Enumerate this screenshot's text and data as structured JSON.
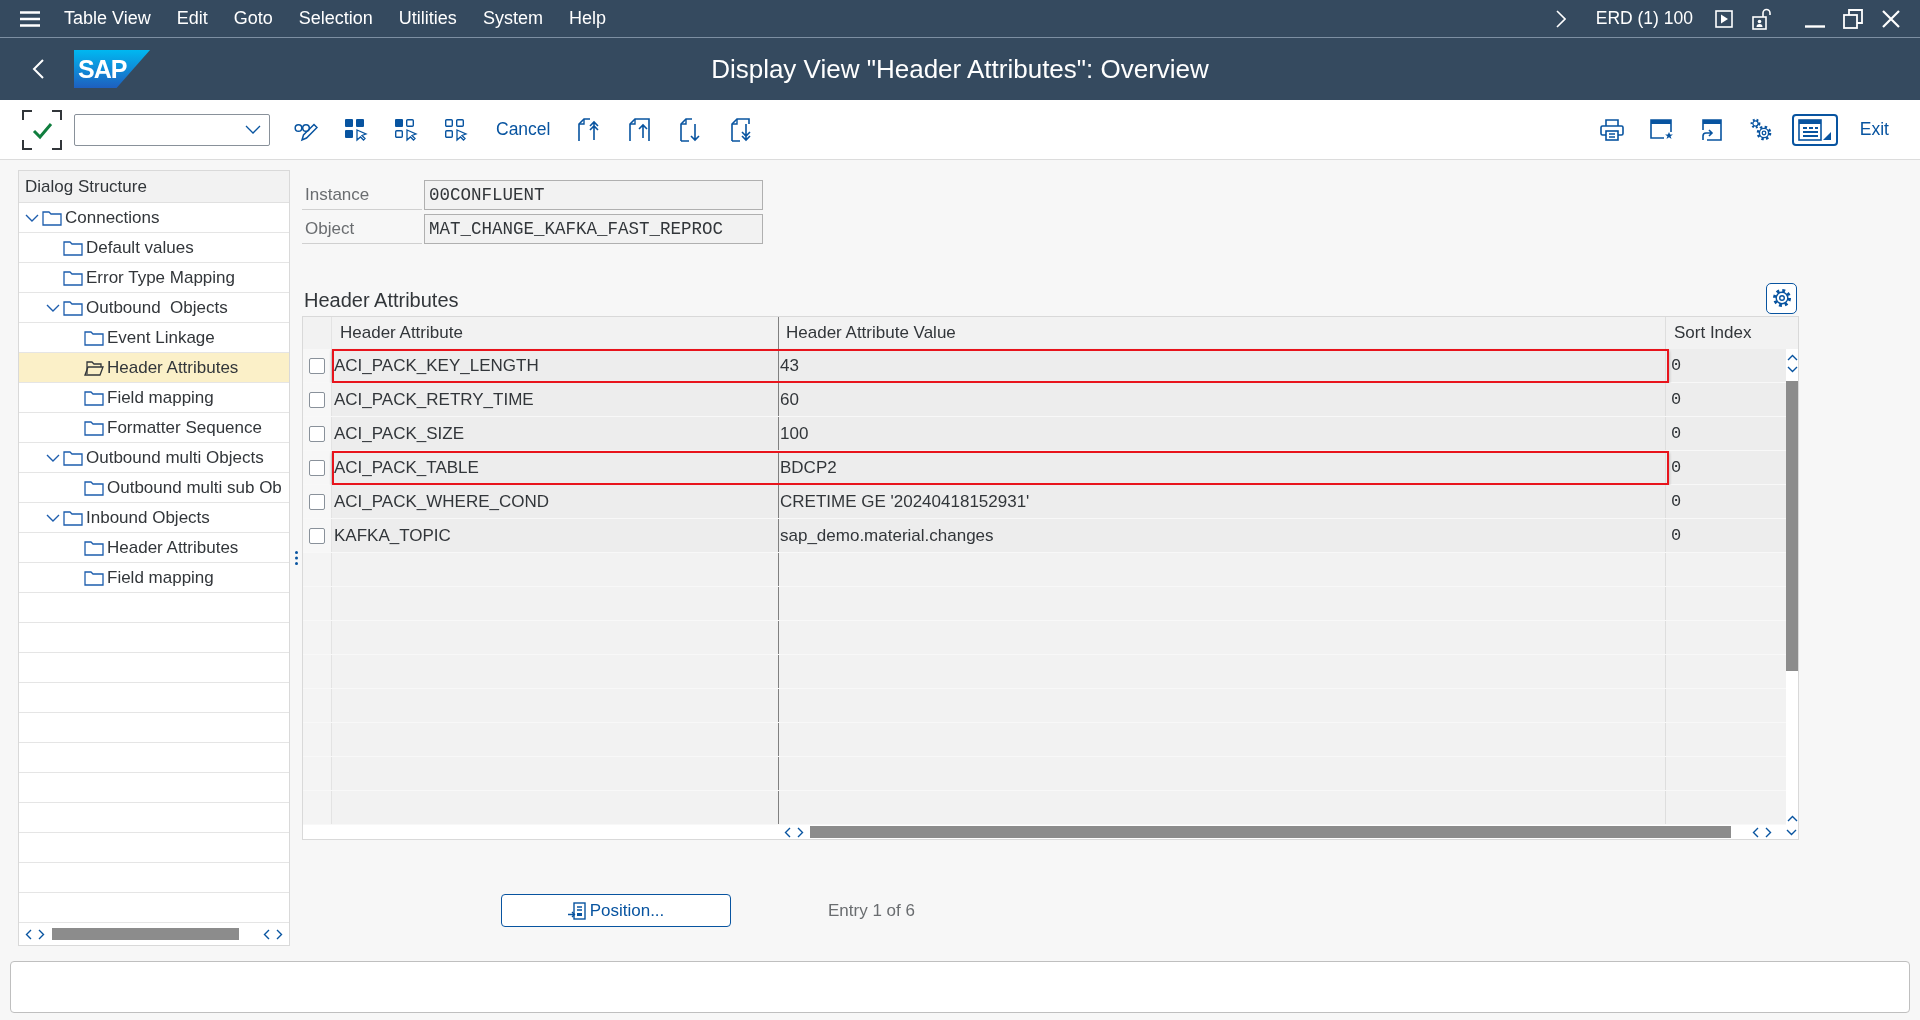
{
  "menu_bar": {
    "items": [
      "Table View",
      "Edit",
      "Goto",
      "Selection",
      "Utilities",
      "System",
      "Help"
    ],
    "system_info": "ERD (1) 100"
  },
  "title_bar": {
    "logo": "SAP",
    "title": "Display View \"Header Attributes\": Overview"
  },
  "toolbar": {
    "cancel_label": "Cancel",
    "exit_label": "Exit"
  },
  "dialog_structure": {
    "title": "Dialog Structure",
    "tree": [
      {
        "label": "Connections",
        "expanded": true,
        "selected": false,
        "children": [
          {
            "label": "Default values",
            "selected": false
          },
          {
            "label": "Error Type Mapping",
            "selected": false
          },
          {
            "label": "Outbound  Objects",
            "expanded": true,
            "selected": false,
            "children": [
              {
                "label": "Event Linkage",
                "selected": false
              },
              {
                "label": "Header Attributes",
                "selected": true
              },
              {
                "label": "Field mapping",
                "selected": false
              },
              {
                "label": "Formatter Sequence",
                "selected": false
              }
            ]
          },
          {
            "label": "Outbound multi Objects",
            "expanded": true,
            "selected": false,
            "children": [
              {
                "label": "Outbound multi sub Ob",
                "selected": false
              }
            ]
          },
          {
            "label": "Inbound Objects",
            "expanded": true,
            "selected": false,
            "children": [
              {
                "label": "Header Attributes",
                "selected": false
              },
              {
                "label": "Field mapping",
                "selected": false
              }
            ]
          }
        ]
      }
    ]
  },
  "form": {
    "fields": [
      {
        "label": "Instance",
        "value": "00CONFLUENT"
      },
      {
        "label": "Object",
        "value": "MAT_CHANGE_KAFKA_FAST_REPROC"
      }
    ]
  },
  "table": {
    "title": "Header Attributes",
    "columns": [
      "Header Attribute",
      "Header Attribute Value",
      "Sort Index"
    ],
    "rows": [
      {
        "selected": false,
        "highlighted": true,
        "cells": [
          "ACI_PACK_KEY_LENGTH",
          "43",
          "0"
        ]
      },
      {
        "selected": false,
        "highlighted": false,
        "cells": [
          "ACI_PACK_RETRY_TIME",
          "60",
          "0"
        ]
      },
      {
        "selected": false,
        "highlighted": false,
        "cells": [
          "ACI_PACK_SIZE",
          "100",
          "0"
        ]
      },
      {
        "selected": false,
        "highlighted": true,
        "cells": [
          "ACI_PACK_TABLE",
          "BDCP2",
          "0"
        ]
      },
      {
        "selected": false,
        "highlighted": false,
        "cells": [
          "ACI_PACK_WHERE_COND",
          "CRETIME GE '20240418152931'",
          "0"
        ]
      },
      {
        "selected": false,
        "highlighted": false,
        "cells": [
          "KAFKA_TOPIC",
          "sap_demo.material.changes",
          "0"
        ]
      }
    ]
  },
  "footer": {
    "position_button": "Position...",
    "entry_info": "Entry 1 of 6"
  }
}
